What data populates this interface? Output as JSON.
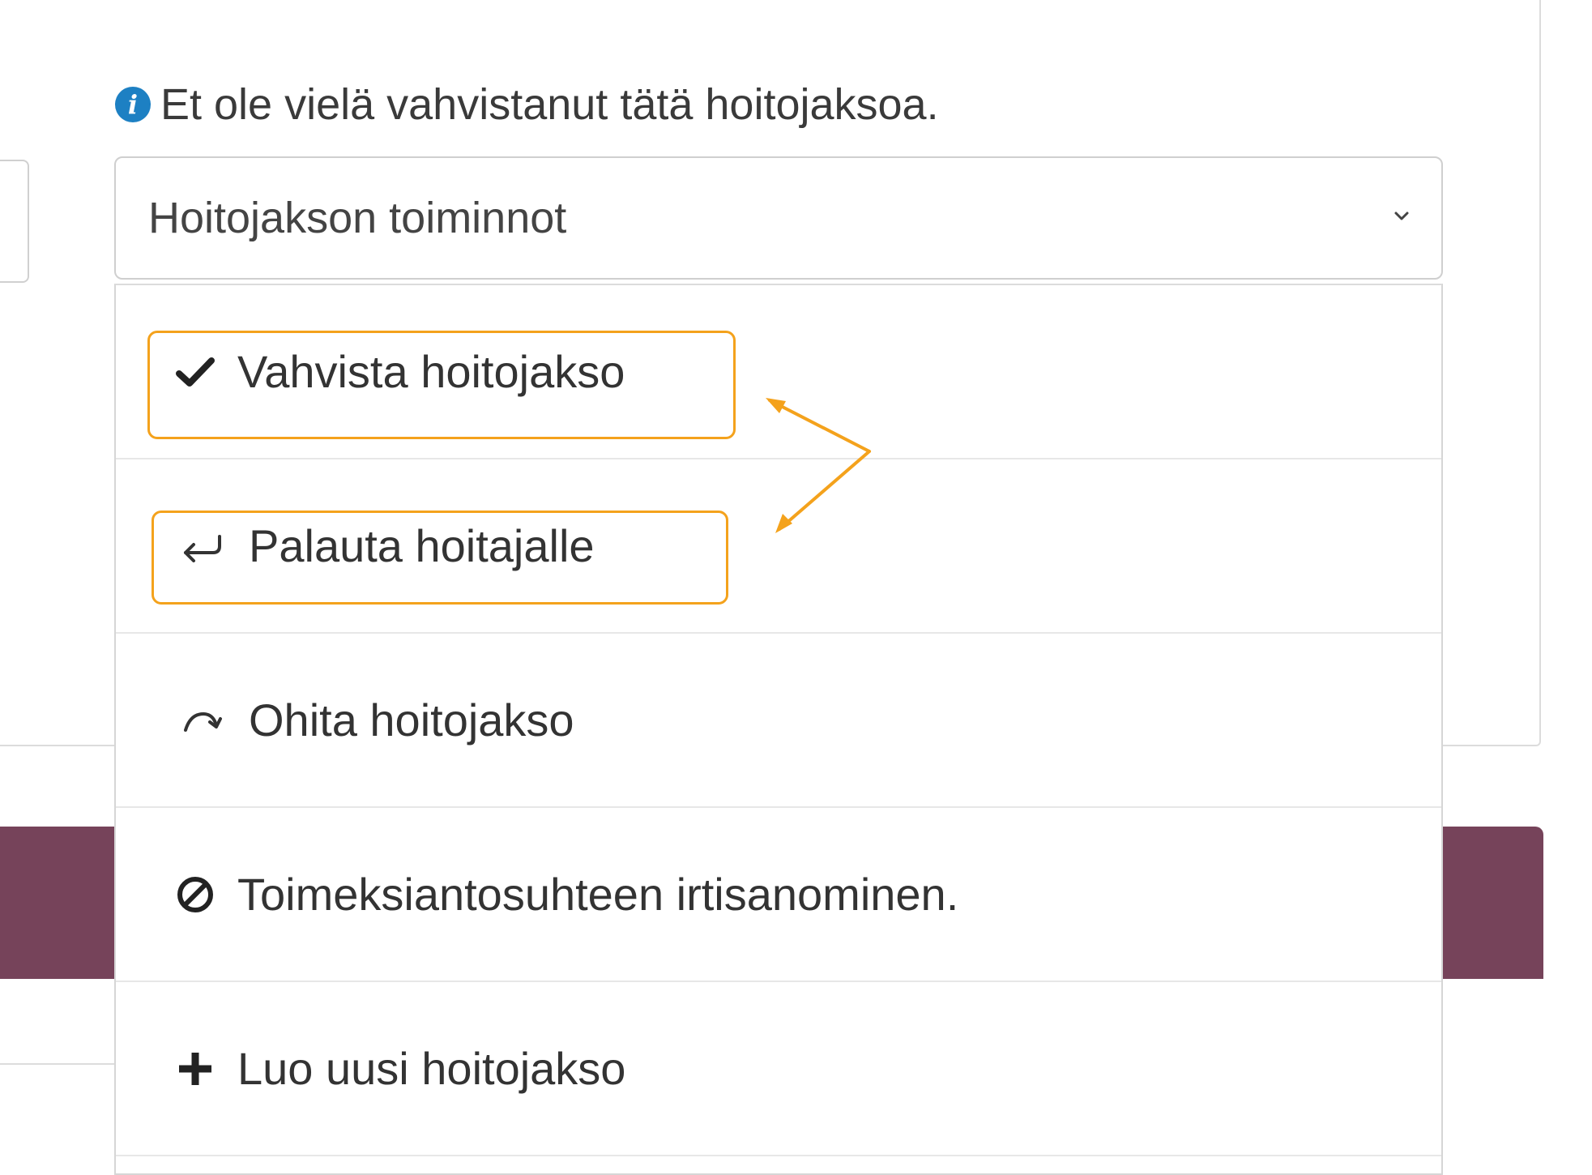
{
  "notice": {
    "icon": "info-circle-icon",
    "text": "Et ole vielä vahvistanut tätä hoitojaksoa."
  },
  "actions_select": {
    "label": "Hoitojakson toiminnot",
    "icon": "chevron-down-icon"
  },
  "menu": {
    "items": [
      {
        "label": "Vahvista hoitojakso",
        "icon": "check-icon",
        "highlighted": true
      },
      {
        "label": "Palauta hoitajalle",
        "icon": "return-arrow-icon",
        "highlighted": true
      },
      {
        "label": "Ohita hoitojakso",
        "icon": "redo-arrow-icon",
        "highlighted": false
      },
      {
        "label": "Toimeksiantosuhteen irtisanominen.",
        "icon": "ban-icon",
        "highlighted": false
      },
      {
        "label": "Luo uusi hoitojakso",
        "icon": "plus-icon",
        "highlighted": false
      }
    ]
  },
  "colors": {
    "highlight": "#f4a21c",
    "brand_band": "#76435a",
    "info_icon": "#1d80c3"
  }
}
